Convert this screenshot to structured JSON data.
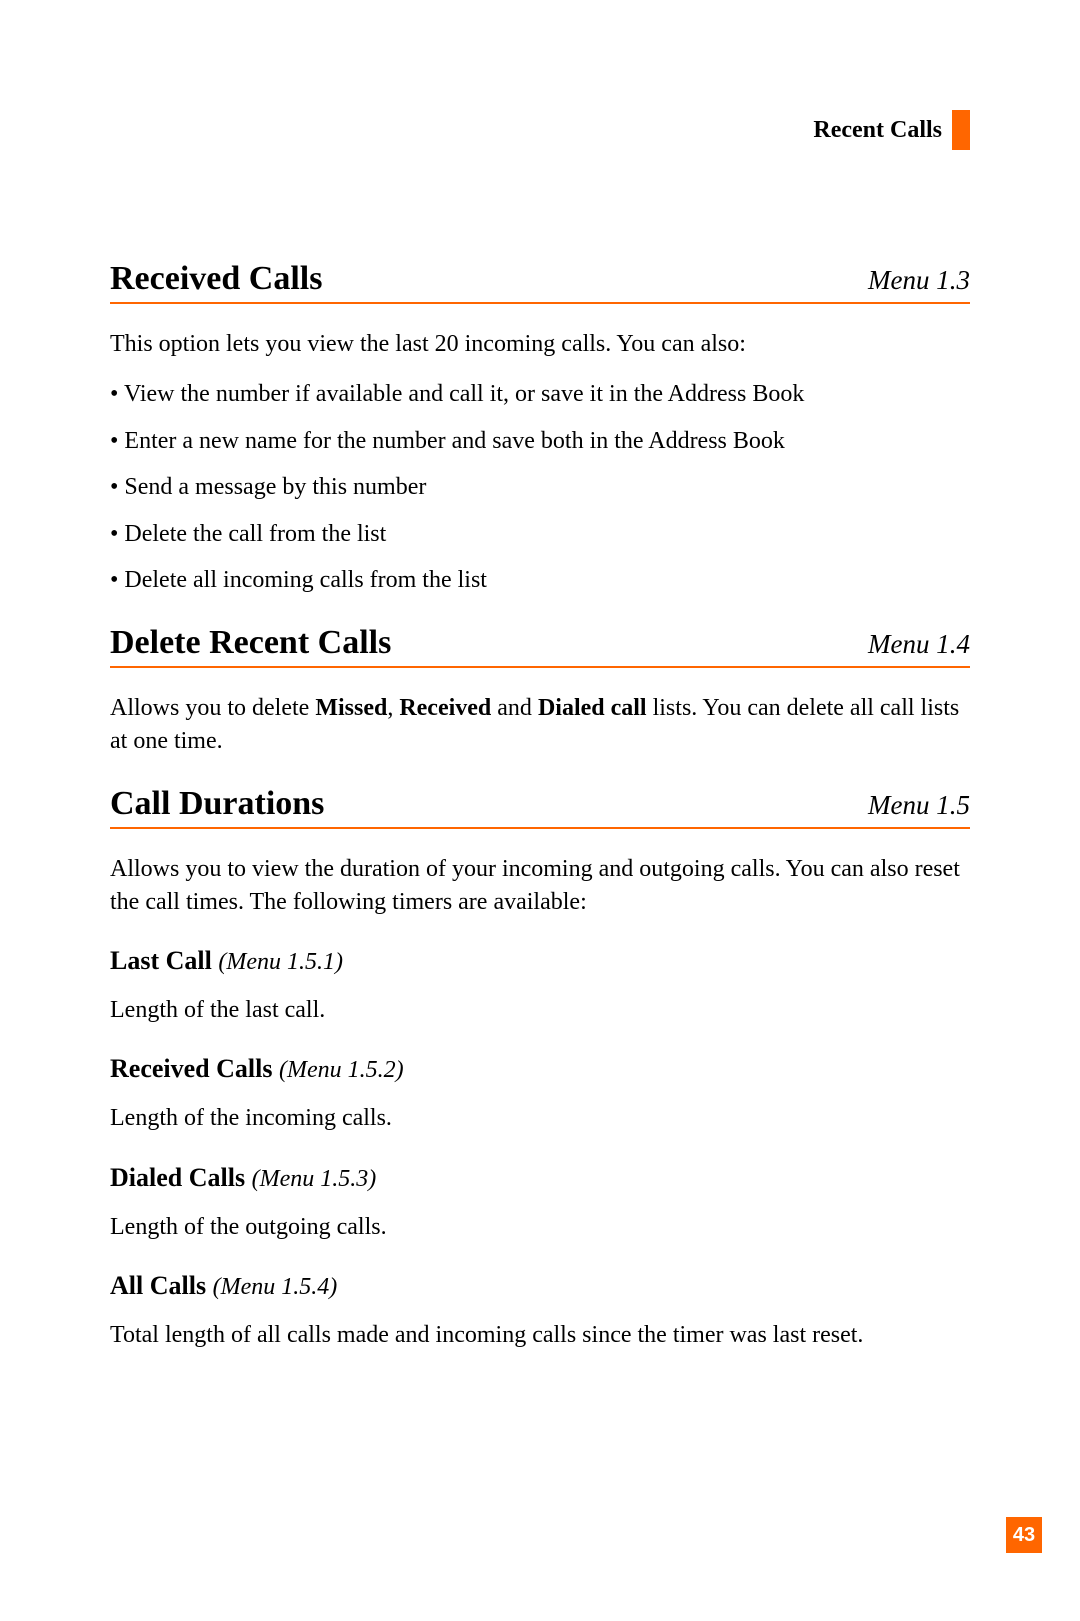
{
  "header": {
    "label": "Recent Calls"
  },
  "page_number": "43",
  "sections": [
    {
      "title": "Received Calls",
      "menu": "Menu 1.3",
      "intro": "This option lets you view the last 20 incoming calls. You can also:",
      "bullets": [
        "View the number if available and call it, or save it in the Address Book",
        "Enter a new name for the number and save both in the Address Book",
        "Send a message by this number",
        "Delete the call from the list",
        "Delete all incoming calls from the list"
      ]
    },
    {
      "title": "Delete Recent Calls",
      "menu": "Menu 1.4",
      "rich_parts": [
        {
          "t": "Allows you to delete ",
          "b": false
        },
        {
          "t": "Missed",
          "b": true
        },
        {
          "t": ", ",
          "b": false
        },
        {
          "t": "Received",
          "b": true
        },
        {
          "t": " and ",
          "b": false
        },
        {
          "t": "Dialed call",
          "b": true
        },
        {
          "t": " lists. You can delete all call lists at one time.",
          "b": false
        }
      ]
    },
    {
      "title": "Call Durations",
      "menu": "Menu 1.5",
      "intro": "Allows you to view the duration of your incoming and outgoing calls. You can also reset the call times. The following timers are available:",
      "subs": [
        {
          "title": "Last Call",
          "menu": "(Menu 1.5.1)",
          "body": "Length of the last call."
        },
        {
          "title": "Received Calls",
          "menu": "(Menu 1.5.2)",
          "body": "Length of the incoming calls."
        },
        {
          "title": "Dialed Calls",
          "menu": "(Menu 1.5.3)",
          "body": "Length of the outgoing calls."
        },
        {
          "title": "All Calls",
          "menu": "(Menu 1.5.4)",
          "body": "Total length of all calls made and incoming calls since the timer was last reset."
        }
      ]
    }
  ]
}
